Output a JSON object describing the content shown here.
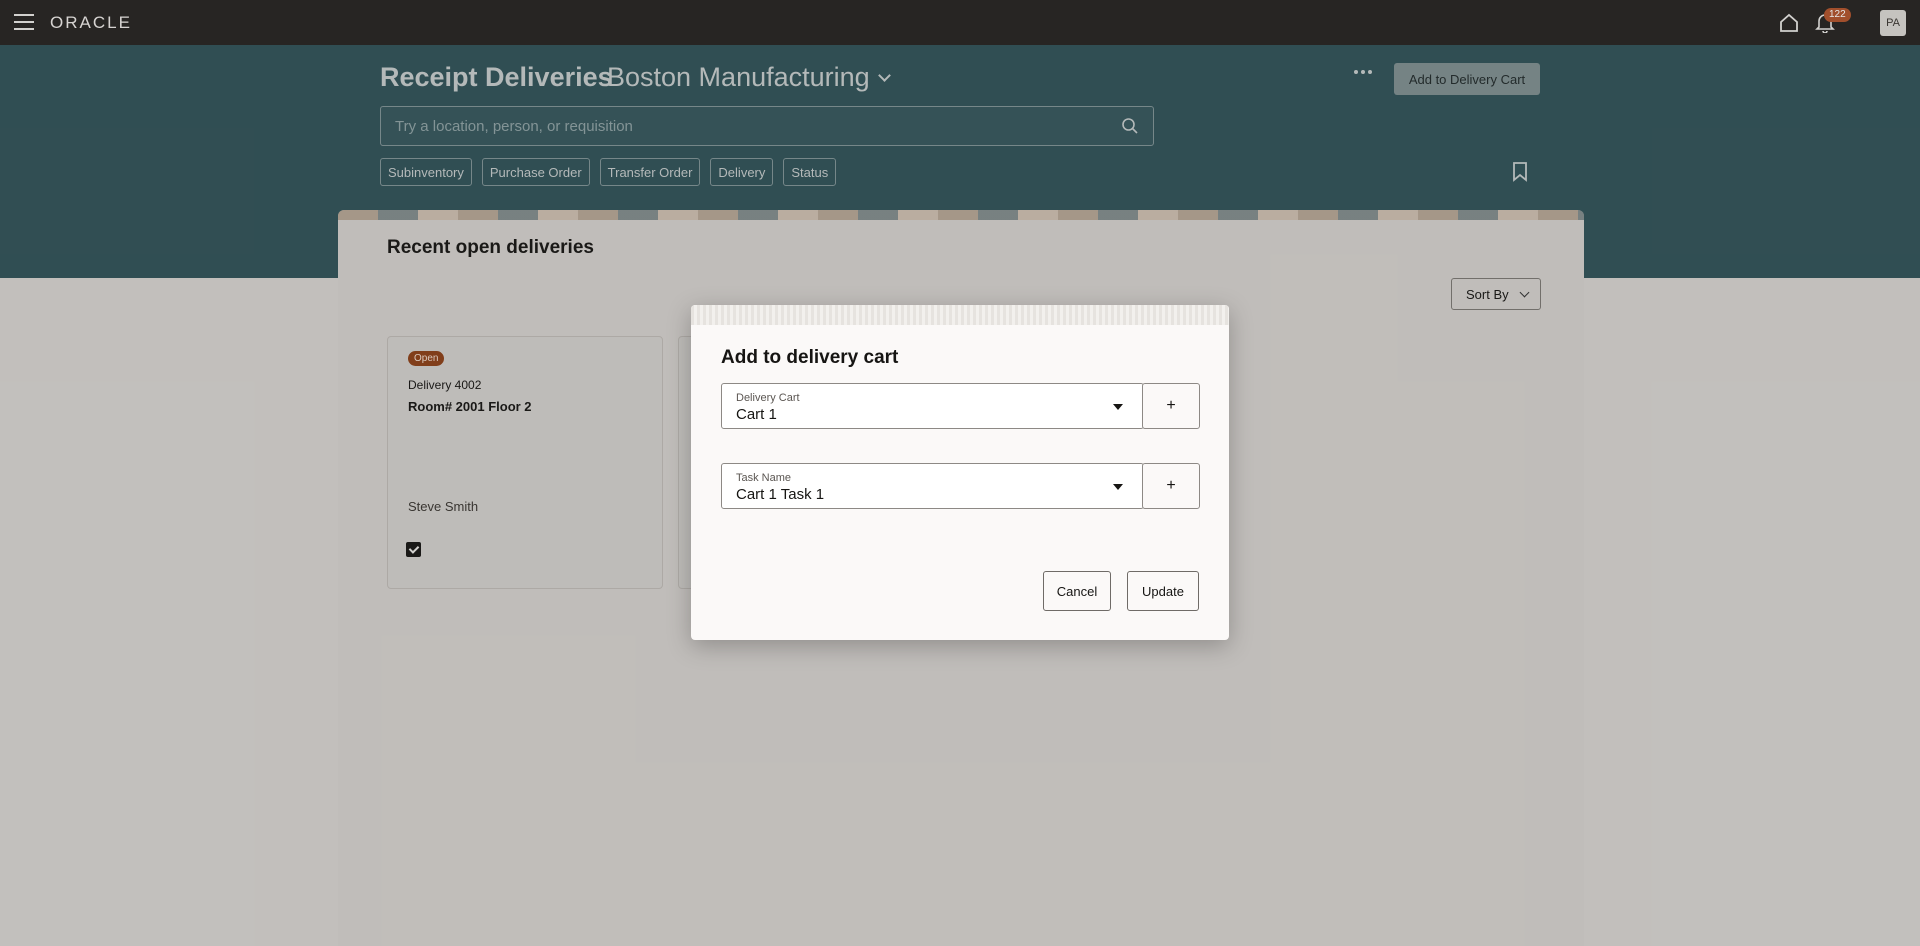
{
  "topbar": {
    "logo": "ORACLE",
    "notification_count": "122",
    "avatar_initials": "PA"
  },
  "header": {
    "title": "Receipt Deliveries",
    "organization": "Boston Manufacturing",
    "add_to_cart_label": "Add to Delivery Cart",
    "search_placeholder": "Try a location, person, or requisition",
    "filters": [
      "Subinventory",
      "Purchase Order",
      "Transfer Order",
      "Delivery",
      "Status"
    ]
  },
  "content": {
    "section_title": "Recent open deliveries",
    "sort_label": "Sort By",
    "cards": [
      {
        "status": "Open",
        "delivery": "Delivery 4002",
        "location": "Room# 2001 Floor 2",
        "person": "Steve Smith",
        "selected": true
      }
    ]
  },
  "dialog": {
    "title": "Add to delivery cart",
    "delivery_cart_label": "Delivery Cart",
    "delivery_cart_value": "Cart 1",
    "task_name_label": "Task Name",
    "task_name_value": "Cart 1 Task 1",
    "add_symbol": "+",
    "cancel_label": "Cancel",
    "update_label": "Update"
  },
  "colors": {
    "topbar": "#252320",
    "header_band": "#2f5157",
    "status_open": "#8b3f16"
  }
}
